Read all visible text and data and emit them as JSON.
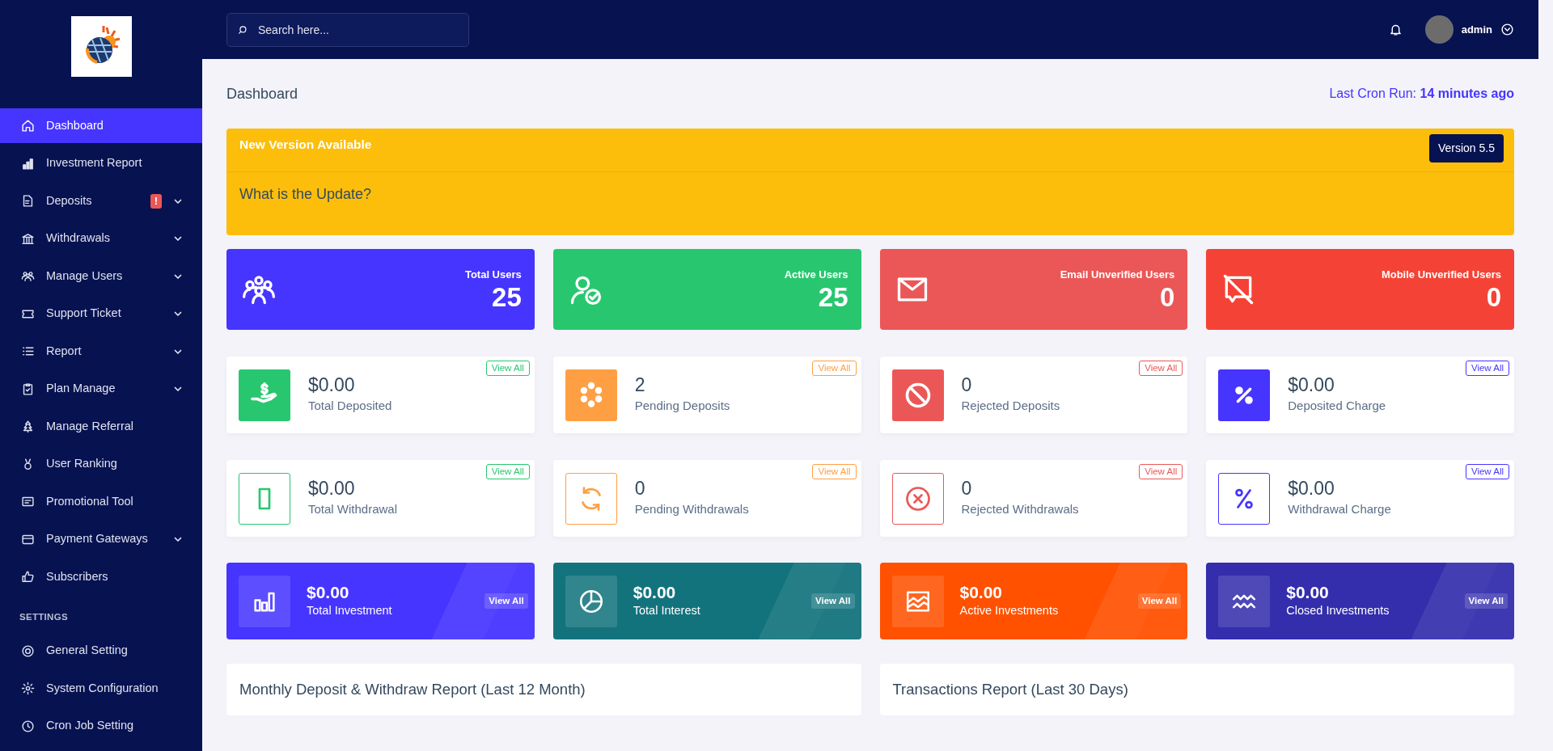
{
  "sidebar": {
    "items": [
      {
        "label": "Dashboard",
        "selected": true,
        "expandable": false
      },
      {
        "label": "Investment Report",
        "selected": false,
        "expandable": false
      },
      {
        "label": "Deposits",
        "selected": false,
        "expandable": true,
        "badge": "!"
      },
      {
        "label": "Withdrawals",
        "selected": false,
        "expandable": true
      },
      {
        "label": "Manage Users",
        "selected": false,
        "expandable": true
      },
      {
        "label": "Support Ticket",
        "selected": false,
        "expandable": true
      },
      {
        "label": "Report",
        "selected": false,
        "expandable": true
      },
      {
        "label": "Plan Manage",
        "selected": false,
        "expandable": true
      },
      {
        "label": "Manage Referral",
        "selected": false,
        "expandable": false
      },
      {
        "label": "User Ranking",
        "selected": false,
        "expandable": false
      },
      {
        "label": "Promotional Tool",
        "selected": false,
        "expandable": false
      },
      {
        "label": "Payment Gateways",
        "selected": false,
        "expandable": true
      },
      {
        "label": "Subscribers",
        "selected": false,
        "expandable": false
      }
    ],
    "settings_heading": "SETTINGS",
    "settings_items": [
      {
        "label": "General Setting",
        "selected": false,
        "expandable": false
      },
      {
        "label": "System Configuration",
        "selected": false,
        "expandable": false
      },
      {
        "label": "Cron Job Setting",
        "selected": false,
        "expandable": false
      }
    ]
  },
  "topbar": {
    "search": {
      "placeholder": "Search here..."
    },
    "user": {
      "name": "admin"
    }
  },
  "page": {
    "title": "Dashboard",
    "cron": "Last Cron Run: **14 minutes ago**"
  },
  "update_banner": {
    "title": "New Version Available",
    "version": "Version 5.5",
    "question": "What is the Update?"
  },
  "user_stats": [
    {
      "label": "Total Users",
      "value": "25",
      "color": "#4634ff"
    },
    {
      "label": "Active Users",
      "value": "25",
      "color": "#28c76f"
    },
    {
      "label": "Email Unverified Users",
      "value": "0",
      "color": "#eb5757"
    },
    {
      "label": "Mobile Unverified Users",
      "value": "0",
      "color": "#f44336"
    }
  ],
  "finance_stats": [
    {
      "value": "$0.00",
      "label": "Total Deposited",
      "color": "#28c76f",
      "kind": "solid",
      "action": "View All"
    },
    {
      "value": "2",
      "label": "Pending Deposits",
      "color": "#ff9f43",
      "kind": "solid",
      "action": "View All"
    },
    {
      "value": "0",
      "label": "Rejected Deposits",
      "color": "#eb5757",
      "kind": "solid",
      "action": "View All"
    },
    {
      "value": "$0.00",
      "label": "Deposited Charge",
      "color": "#4634ff",
      "kind": "solid",
      "action": "View All"
    },
    {
      "value": "$0.00",
      "label": "Total Withdrawal",
      "color": "#28c76f",
      "kind": "outline",
      "action": "View All"
    },
    {
      "value": "0",
      "label": "Pending Withdrawals",
      "color": "#ff9f43",
      "kind": "outline",
      "action": "View All"
    },
    {
      "value": "0",
      "label": "Rejected Withdrawals",
      "color": "#eb5757",
      "kind": "outline",
      "action": "View All"
    },
    {
      "value": "$0.00",
      "label": "Withdrawal Charge",
      "color": "#4634ff",
      "kind": "outline",
      "action": "View All"
    }
  ],
  "investment_stats": [
    {
      "value": "$0.00",
      "label": "Total Investment",
      "color": "#4634ff",
      "action": "View All"
    },
    {
      "value": "$0.00",
      "label": "Total Interest",
      "color": "#13737d",
      "action": "View All"
    },
    {
      "value": "$0.00",
      "label": "Active Investments",
      "color": "#ff5100",
      "action": "View All"
    },
    {
      "value": "$0.00",
      "label": "Closed Investments",
      "color": "#342ead",
      "action": "View All"
    }
  ],
  "reports": [
    {
      "title": "Monthly Deposit & Withdraw Report (Last 12 Month)"
    },
    {
      "title": "Transactions Report (Last 30 Days)"
    }
  ]
}
